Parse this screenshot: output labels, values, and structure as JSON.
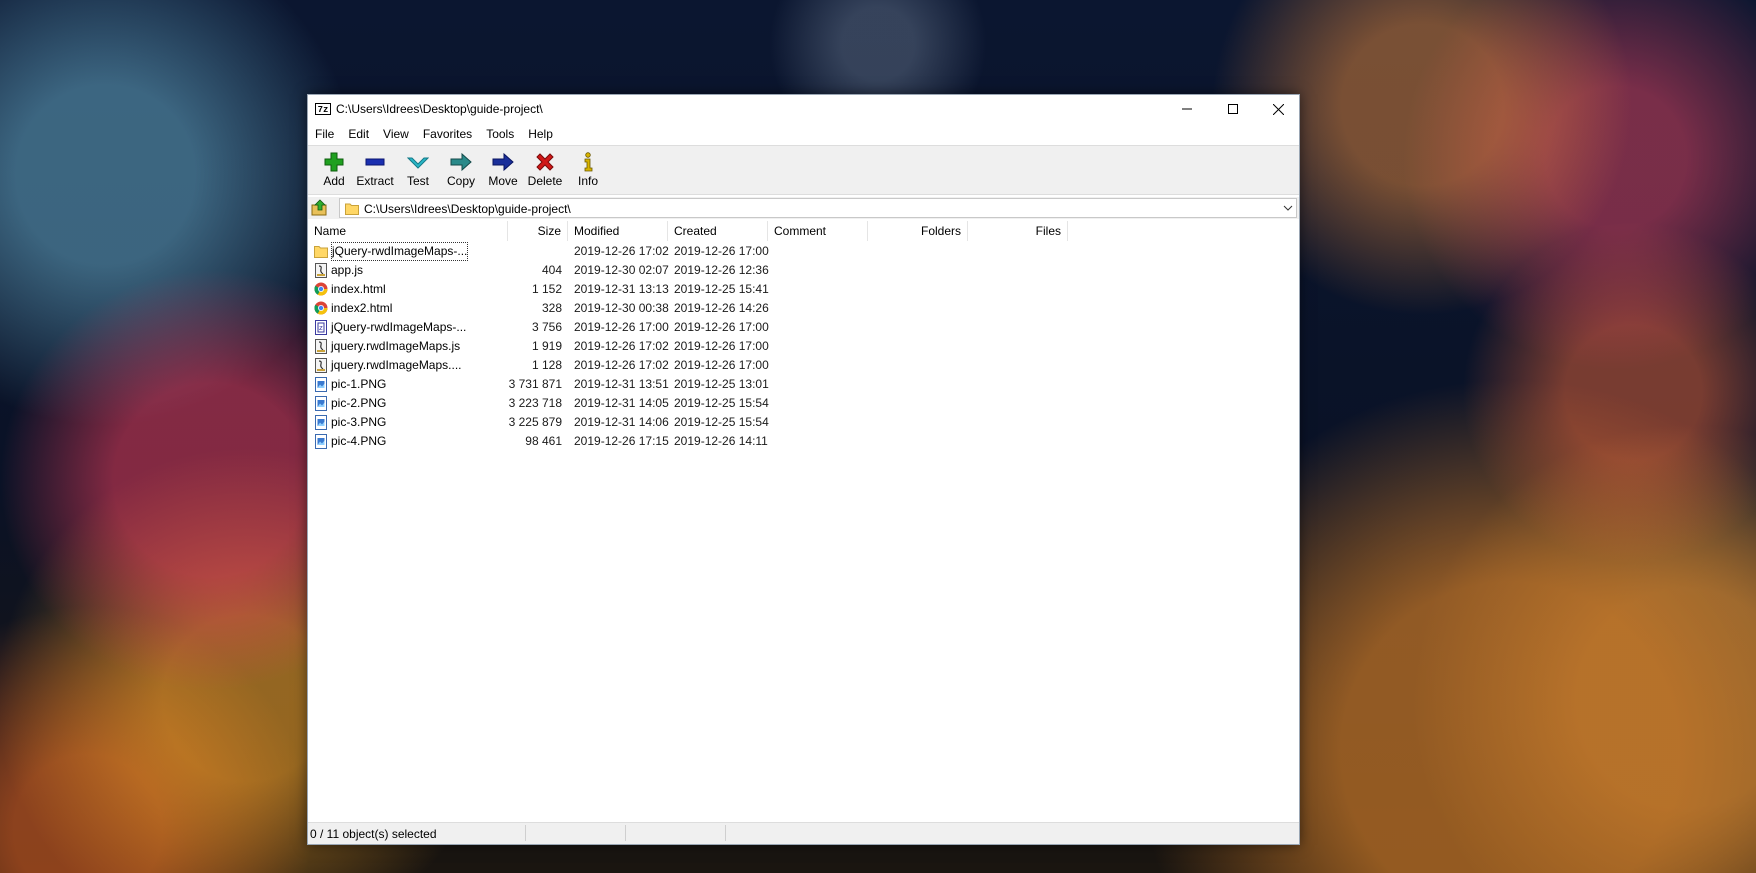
{
  "window": {
    "app_icon_text": "7z",
    "title": "C:\\Users\\Idrees\\Desktop\\guide-project\\"
  },
  "menu": [
    "File",
    "Edit",
    "View",
    "Favorites",
    "Tools",
    "Help"
  ],
  "toolbar": {
    "add": "Add",
    "extract": "Extract",
    "test": "Test",
    "copy": "Copy",
    "move": "Move",
    "delete": "Delete",
    "info": "Info"
  },
  "address": {
    "path": "C:\\Users\\Idrees\\Desktop\\guide-project\\"
  },
  "columns": {
    "name": "Name",
    "size": "Size",
    "modified": "Modified",
    "created": "Created",
    "comment": "Comment",
    "folders": "Folders",
    "files": "Files"
  },
  "files": [
    {
      "name": "jQuery-rwdImageMaps-...",
      "size": "",
      "modified": "2019-12-26 17:02",
      "created": "2019-12-26 17:00",
      "icon": "folder-icon"
    },
    {
      "name": "app.js",
      "size": "404",
      "modified": "2019-12-30 02:07",
      "created": "2019-12-26 12:36",
      "icon": "script-file-icon"
    },
    {
      "name": "index.html",
      "size": "1 152",
      "modified": "2019-12-31 13:13",
      "created": "2019-12-25 15:41",
      "icon": "chrome-html-icon"
    },
    {
      "name": "index2.html",
      "size": "328",
      "modified": "2019-12-30 00:38",
      "created": "2019-12-26 14:26",
      "icon": "chrome-html-icon"
    },
    {
      "name": "jQuery-rwdImageMaps-...",
      "size": "3 756",
      "modified": "2019-12-26 17:00",
      "created": "2019-12-26 17:00",
      "icon": "archive-file-icon"
    },
    {
      "name": "jquery.rwdImageMaps.js",
      "size": "1 919",
      "modified": "2019-12-26 17:02",
      "created": "2019-12-26 17:00",
      "icon": "script-file-icon"
    },
    {
      "name": "jquery.rwdImageMaps....",
      "size": "1 128",
      "modified": "2019-12-26 17:02",
      "created": "2019-12-26 17:00",
      "icon": "script-file-icon"
    },
    {
      "name": "pic-1.PNG",
      "size": "3 731 871",
      "modified": "2019-12-31 13:51",
      "created": "2019-12-25 13:01",
      "icon": "image-file-icon"
    },
    {
      "name": "pic-2.PNG",
      "size": "3 223 718",
      "modified": "2019-12-31 14:05",
      "created": "2019-12-25 15:54",
      "icon": "image-file-icon"
    },
    {
      "name": "pic-3.PNG",
      "size": "3 225 879",
      "modified": "2019-12-31 14:06",
      "created": "2019-12-25 15:54",
      "icon": "image-file-icon"
    },
    {
      "name": "pic-4.PNG",
      "size": "98 461",
      "modified": "2019-12-26 17:15",
      "created": "2019-12-26 14:11",
      "icon": "image-file-icon"
    }
  ],
  "status": {
    "selection": "0 / 11 object(s) selected"
  },
  "colors": {
    "add": "#1fa01f",
    "extract": "#1a2fb0",
    "test": "#2ab8c8",
    "copy": "#2a8a8a",
    "move": "#1a2f9a",
    "delete": "#d01818",
    "info": "#d8b400",
    "folder": "#ffd766"
  }
}
